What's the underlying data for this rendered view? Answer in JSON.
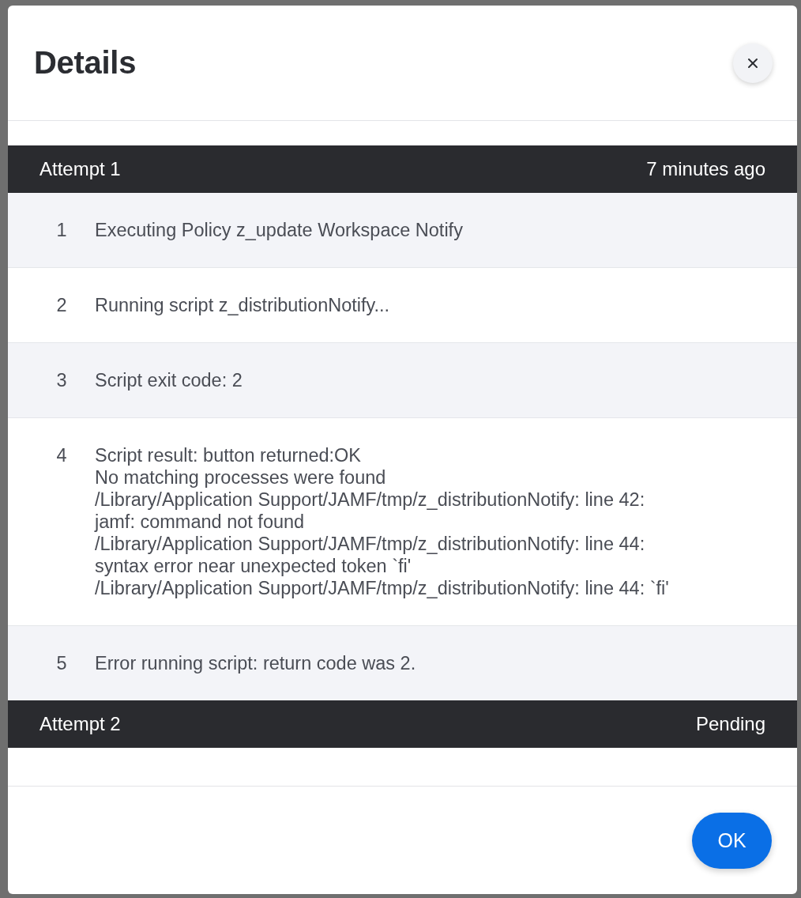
{
  "dialog": {
    "title": "Details"
  },
  "attempts": [
    {
      "title": "Attempt 1",
      "status": "7 minutes ago",
      "entries": [
        {
          "number": "1",
          "lines": [
            "Executing Policy z_update Workspace Notify"
          ]
        },
        {
          "number": "2",
          "lines": [
            "Running script z_distributionNotify..."
          ]
        },
        {
          "number": "3",
          "lines": [
            "Script exit code: 2"
          ]
        },
        {
          "number": "4",
          "lines": [
            "Script result: button returned:OK",
            "No matching processes were found",
            "/Library/Application Support/JAMF/tmp/z_distributionNotify: line 42:",
            "jamf: command not found",
            "/Library/Application Support/JAMF/tmp/z_distributionNotify: line 44:",
            "syntax error near unexpected token `fi'",
            "/Library/Application Support/JAMF/tmp/z_distributionNotify: line 44: `fi'"
          ]
        },
        {
          "number": "5",
          "lines": [
            "Error running script: return code was 2."
          ]
        }
      ]
    },
    {
      "title": "Attempt 2",
      "status": "Pending"
    }
  ],
  "footer": {
    "ok_button": {
      "label": "OK"
    }
  }
}
